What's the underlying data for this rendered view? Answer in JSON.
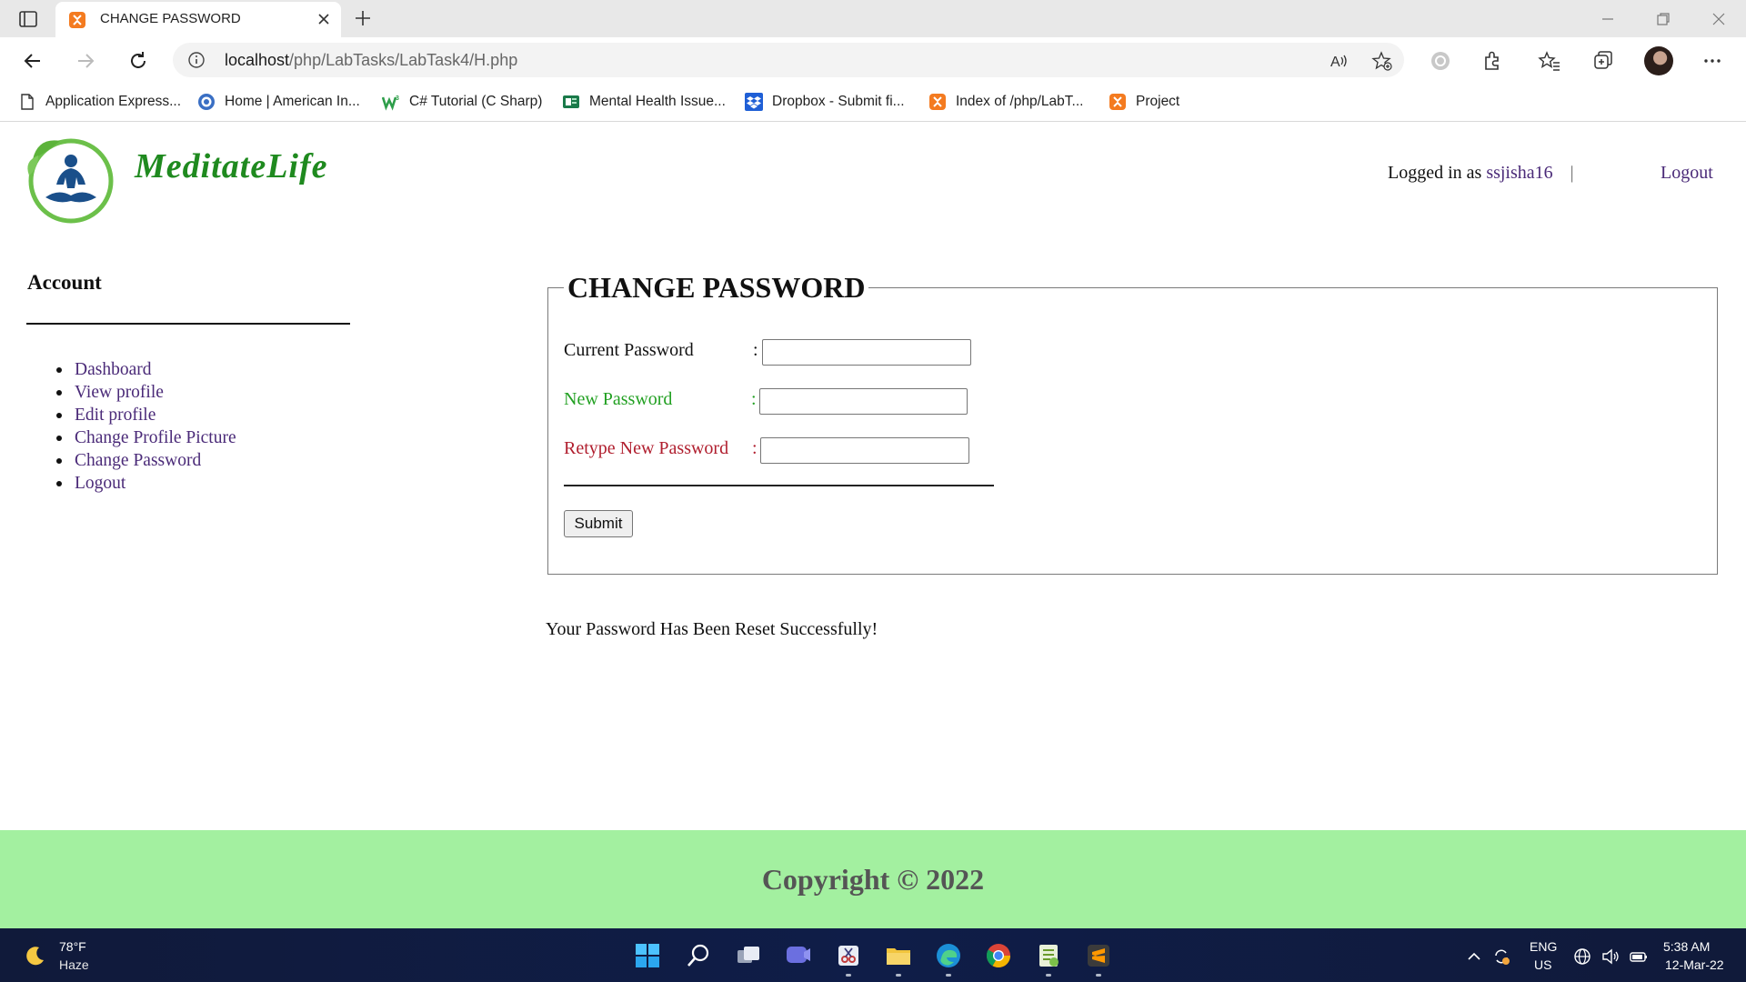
{
  "browser": {
    "tab": {
      "title": "CHANGE PASSWORD"
    },
    "address": {
      "host": "localhost",
      "path": "/php/LabTasks/LabTask4/H.php"
    },
    "bookmarks": [
      {
        "label": "Application Express...",
        "icon": "page-icon"
      },
      {
        "label": "Home | American In...",
        "icon": "globe-icon"
      },
      {
        "label": "C# Tutorial (C Sharp)",
        "icon": "w3-icon"
      },
      {
        "label": "Mental Health Issue...",
        "icon": "green-doc-icon"
      },
      {
        "label": "Dropbox - Submit fi...",
        "icon": "dropbox-icon"
      },
      {
        "label": "Index of /php/LabT...",
        "icon": "xampp-icon"
      },
      {
        "label": "Project",
        "icon": "xampp-icon"
      }
    ]
  },
  "site": {
    "logo_text": "MeditateLife",
    "login_prefix": "Logged in as",
    "username": "ssjisha16",
    "separator": "|",
    "logout_label": "Logout"
  },
  "sidebar": {
    "title": "Account",
    "items": [
      {
        "label": "Dashboard"
      },
      {
        "label": "View profile"
      },
      {
        "label": "Edit profile"
      },
      {
        "label": "Change Profile Picture"
      },
      {
        "label": "Change Password"
      },
      {
        "label": "Logout"
      }
    ]
  },
  "form": {
    "legend": "CHANGE PASSWORD",
    "current_label": "Current Password",
    "new_label": "New Password",
    "retype_label": "Retype New Password",
    "colon": ":",
    "current_value": "",
    "new_value": "",
    "retype_value": "",
    "submit_label": "Submit",
    "colors": {
      "current": "#111111",
      "new": "#22a022",
      "retype": "#b01e2e"
    }
  },
  "message": "Your Password Has Been Reset Successfully!",
  "footer": {
    "copyright": "Copyright © 2022",
    "background": "#a3f0a0"
  },
  "taskbar": {
    "temperature": "78°F",
    "weather": "Haze",
    "lang_line1": "ENG",
    "lang_line2": "US",
    "time": "5:38 AM",
    "date": "12-Mar-22"
  }
}
